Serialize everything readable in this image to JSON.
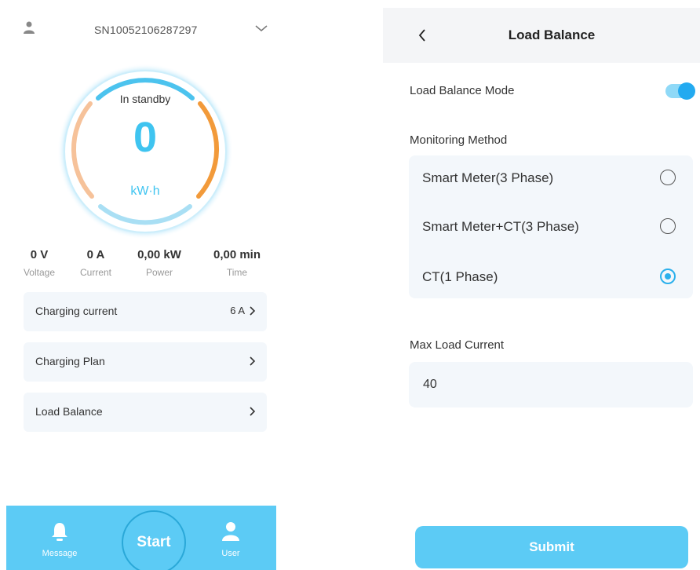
{
  "left_screen": {
    "serial_number": "SN10052106287297",
    "gauge": {
      "status": "In standby",
      "value": "0",
      "unit": "kW·h"
    },
    "stats": [
      {
        "value": "0 V",
        "label": "Voltage"
      },
      {
        "value": "0 A",
        "label": "Current"
      },
      {
        "value": "0,00 kW",
        "label": "Power"
      },
      {
        "value": "0,00 min",
        "label": "Time"
      }
    ],
    "menu": {
      "charging_current": {
        "label": "Charging current",
        "value": "6 A"
      },
      "charging_plan": {
        "label": "Charging Plan"
      },
      "load_balance": {
        "label": "Load Balance"
      }
    },
    "tabbar": {
      "message": "Message",
      "start": "Start",
      "user": "User"
    },
    "colors": {
      "accent": "#3fc4f0",
      "tabbar": "#5ccbf5",
      "gauge_orange": "#f29a3a",
      "gauge_peach": "#f6c29a",
      "gauge_blue": "#4cc3ee"
    }
  },
  "right_screen": {
    "title": "Load Balance",
    "load_balance_mode": {
      "label": "Load Balance Mode",
      "enabled": true
    },
    "monitoring_method": {
      "label": "Monitoring Method",
      "options": [
        {
          "label": "Smart Meter(3 Phase)",
          "selected": false
        },
        {
          "label": "Smart Meter+CT(3 Phase)",
          "selected": false
        },
        {
          "label": "CT(1 Phase)",
          "selected": true
        }
      ]
    },
    "max_load_current": {
      "label": "Max Load Current",
      "value": "40"
    },
    "submit_label": "Submit",
    "colors": {
      "accent": "#2bb0ec",
      "button": "#5ccbf5"
    }
  }
}
